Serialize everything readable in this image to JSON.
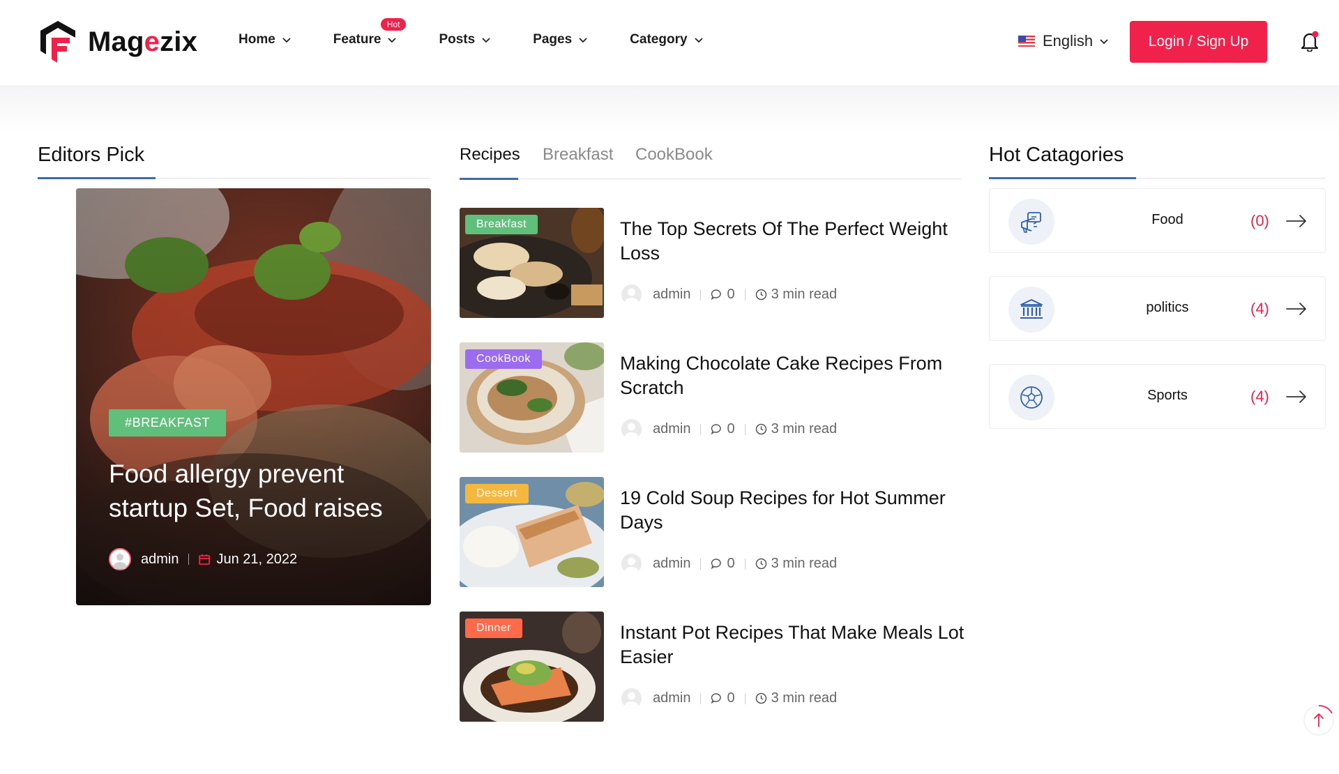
{
  "brand": {
    "name_prefix": "Mag",
    "name_accent": "e",
    "name_suffix": "zix",
    "accent_color": "#f0224b"
  },
  "nav": {
    "items": [
      {
        "label": "Home"
      },
      {
        "label": "Feature",
        "badge": "Hot"
      },
      {
        "label": "Posts"
      },
      {
        "label": "Pages"
      },
      {
        "label": "Category"
      }
    ],
    "language": "English",
    "login_label": "Login / Sign Up"
  },
  "editors_pick": {
    "title": "Editors Pick",
    "featured": {
      "tag": "#BREAKFAST",
      "title": "Food allergy prevent startup Set, Food raises",
      "author": "admin",
      "date": "Jun 21, 2022"
    }
  },
  "tabs": {
    "items": [
      "Recipes",
      "Breakfast",
      "CookBook"
    ],
    "active": "Recipes"
  },
  "posts": [
    {
      "badge": "Breakfast",
      "badge_color": "#5fbf7b",
      "title": "The Top Secrets Of The Perfect Weight Loss",
      "author": "admin",
      "comments": "0",
      "read_time": "3 min read"
    },
    {
      "badge": "CookBook",
      "badge_color": "#9b6cf0",
      "title": "Making Chocolate Cake Recipes From Scratch",
      "author": "admin",
      "comments": "0",
      "read_time": "3 min read"
    },
    {
      "badge": "Dessert",
      "badge_color": "#f5b73d",
      "title": "19 Cold Soup Recipes for Hot Summer Days",
      "author": "admin",
      "comments": "0",
      "read_time": "3 min read"
    },
    {
      "badge": "Dinner",
      "badge_color": "#ff6b4a",
      "title": "Instant Pot Recipes That Make Meals Lot Easier",
      "author": "admin",
      "comments": "0",
      "read_time": "3 min read"
    }
  ],
  "hot_categories": {
    "title": "Hot Catagories",
    "items": [
      {
        "name": "Food",
        "count": "(0)",
        "icon": "megaphone-icon"
      },
      {
        "name": "politics",
        "count": "(4)",
        "icon": "bank-icon"
      },
      {
        "name": "Sports",
        "count": "(4)",
        "icon": "soccer-ball-icon"
      }
    ]
  }
}
